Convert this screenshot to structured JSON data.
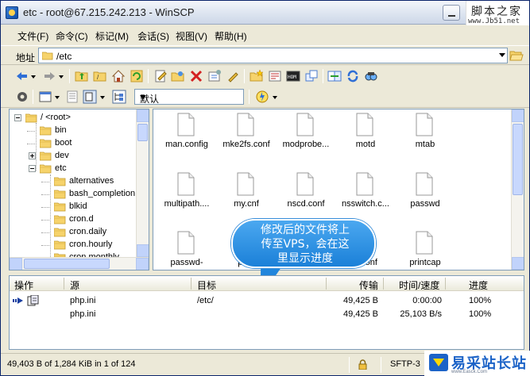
{
  "window": {
    "title": "etc - root@67.215.242.213 - WinSCP"
  },
  "watermark_top": {
    "text": "脚本之家",
    "url": "www.Jb51.net"
  },
  "menu": [
    {
      "label": "文件(F)"
    },
    {
      "label": "命令(C)"
    },
    {
      "label": "标记(M)"
    },
    {
      "label": "会话(S)"
    },
    {
      "label": "视图(V)"
    },
    {
      "label": "帮助(H)"
    }
  ],
  "address": {
    "label": "地址",
    "value": "/etc"
  },
  "toolbar": {
    "session_value": "默认"
  },
  "tree": [
    {
      "label": "/ <root>",
      "expander": "minus"
    },
    {
      "label": "bin"
    },
    {
      "label": "boot"
    },
    {
      "label": "dev",
      "expander": "plus"
    },
    {
      "label": "etc",
      "expander": "minus"
    },
    {
      "label": "alternatives"
    },
    {
      "label": "bash_completion"
    },
    {
      "label": "blkid"
    },
    {
      "label": "cron.d"
    },
    {
      "label": "cron.daily"
    },
    {
      "label": "cron.hourly"
    },
    {
      "label": "cron.monthly"
    }
  ],
  "files": [
    "man.config",
    "mke2fs.conf",
    "modprobe...",
    "motd",
    "mtab",
    "multipath....",
    "my.cnf",
    "nscd.conf",
    "nsswitch.c...",
    "passwd",
    "passwd-",
    "pa...",
    "",
    "...conf",
    "printcap"
  ],
  "callout": {
    "line1": "修改后的文件将上",
    "line2": "传至VPS，会在这",
    "line3": "里显示进度"
  },
  "queue": {
    "columns": [
      "操作",
      "源",
      "目标",
      "传输",
      "时间/速度",
      "进度"
    ],
    "rows": [
      {
        "source": "php.ini",
        "target": "/etc/",
        "transferred": "49,425 B",
        "time": "0:00:00",
        "progress": "100%"
      },
      {
        "source": "php.ini",
        "target": "",
        "transferred": "49,425 B",
        "time": "25,103 B/s",
        "progress": "100%"
      }
    ]
  },
  "status": {
    "text": "49,403 B of 1,284 KiB in 1 of 124",
    "protocol": "SFTP-3"
  },
  "watermark_bottom": {
    "text": "易采站长站",
    "url": "www.Easck.Com"
  }
}
